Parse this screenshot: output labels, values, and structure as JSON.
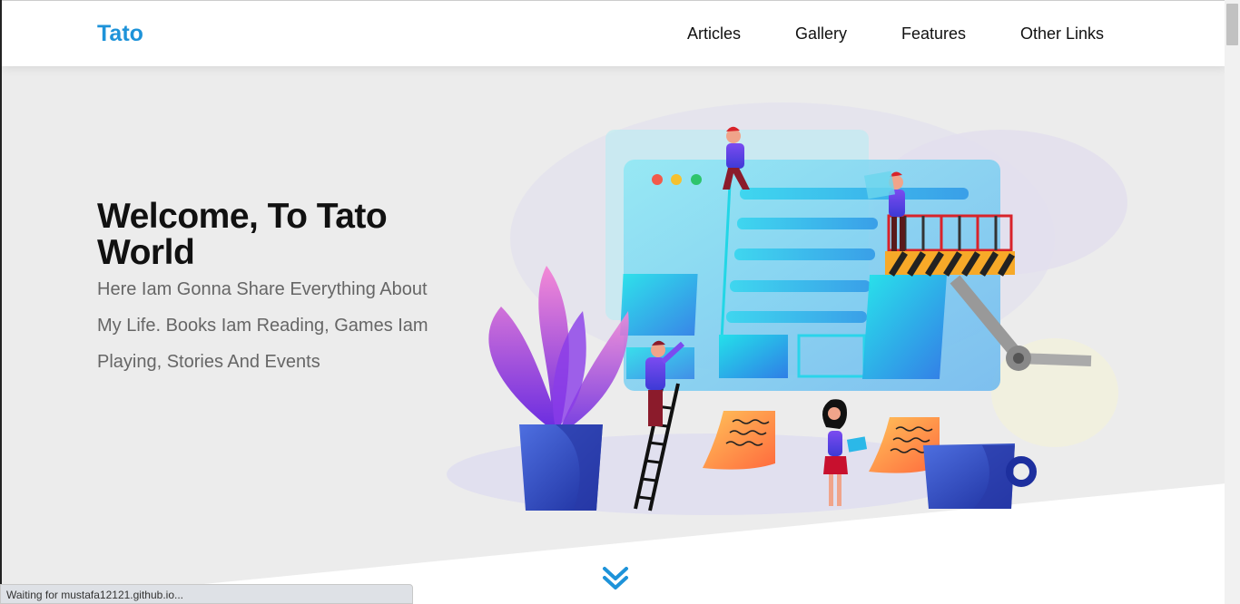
{
  "header": {
    "logo": "Tato",
    "nav": [
      "Articles",
      "Gallery",
      "Features",
      "Other Links"
    ]
  },
  "hero": {
    "title": "Welcome, To Tato World",
    "description": "Here Iam Gonna Share Everything About My Life. Books Iam Reading, Games Iam Playing, Stories And Events"
  },
  "status_bar": {
    "text": "Waiting for mustafa12121.github.io..."
  },
  "colors": {
    "accent": "#1e93d9",
    "hero_bg": "#ececec"
  },
  "icons": {
    "scroll_down": "double-chevron-down-icon"
  }
}
